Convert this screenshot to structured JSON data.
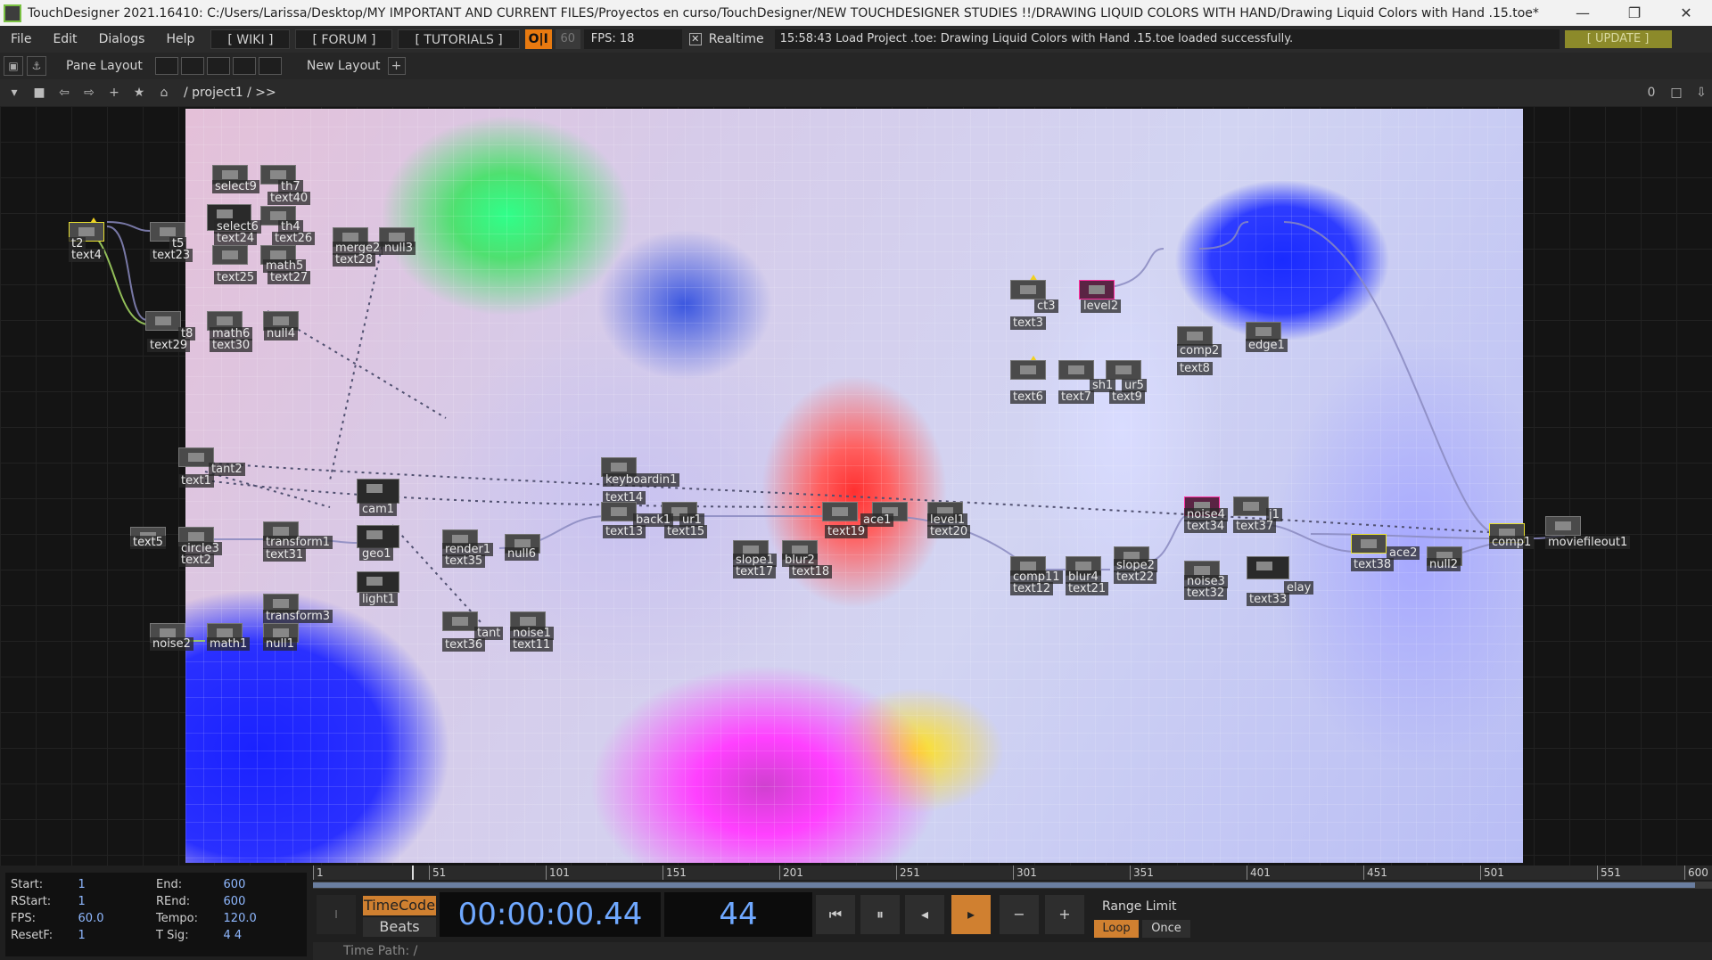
{
  "window": {
    "title": "TouchDesigner 2021.16410: C:/Users/Larissa/Desktop/MY IMPORTANT AND CURRENT FILES/Proyectos en curso/TouchDesigner/NEW TOUCHDESIGNER STUDIES !!/DRAWING LIQUID COLORS WITH HAND/Drawing Liquid Colors with Hand .15.toe*",
    "minimize": "—",
    "restore": "❐",
    "close": "✕"
  },
  "menubar": {
    "file": "File",
    "edit": "Edit",
    "dialogs": "Dialogs",
    "help": "Help",
    "wiki": "[ WIKI ]",
    "forum": "[ FORUM ]",
    "tutorials": "[ TUTORIALS ]",
    "oi": "O|I",
    "fps_target": "60",
    "fps": "FPS: 18",
    "realtime_check": "✕",
    "realtime": "Realtime",
    "status": "15:58:43 Load Project .toe: Drawing Liquid Colors with Hand .15.toe loaded successfully.",
    "update": "[ UPDATE ]"
  },
  "panebar": {
    "pane_layout": "Pane Layout",
    "new_layout": "New Layout",
    "plus": "+"
  },
  "pathbar": {
    "path": "/ project1 / >>",
    "counter": "0"
  },
  "nodes": {
    "t2": "t2",
    "text4": "text4",
    "t5": "t5",
    "text23": "text23",
    "select9": "select9",
    "th7": "th7",
    "text40": "text40",
    "select6": "select6",
    "th4": "th4",
    "text24": "text24",
    "text26": "text26",
    "math5": "math5",
    "text25": "text25",
    "text27": "text27",
    "merge2": "merge2",
    "null3": "null3",
    "text28": "text28",
    "t8": "t8",
    "math6": "math6",
    "null4": "null4",
    "text29": "text29",
    "text30": "text30",
    "tant2": "tant2",
    "text1": "text1",
    "text5": "text5",
    "circle3": "circle3",
    "text2": "text2",
    "transform1": "transform1",
    "text31": "text31",
    "cam1": "cam1",
    "geo1": "geo1",
    "light1": "light1",
    "transform3": "transform3",
    "noise2": "noise2",
    "math1": "math1",
    "null1": "null1",
    "render1": "render1",
    "text35": "text35",
    "null6": "null6",
    "tant": "tant",
    "noise1": "noise1",
    "text36": "text36",
    "text11": "text11",
    "keyboardin1": "keyboardin1",
    "text14": "text14",
    "back1": "back1",
    "ur1": "ur1",
    "text13": "text13",
    "text15": "text15",
    "slope1": "slope1",
    "blur2": "blur2",
    "text17": "text17",
    "text18": "text18",
    "ace1": "ace1",
    "level1": "level1",
    "text19": "text19",
    "text20": "text20",
    "ct3": "ct3",
    "level2": "level2",
    "text3": "text3",
    "comp2": "comp2",
    "text8": "text8",
    "edge1": "edge1",
    "sh1": "sh1",
    "ur5": "ur5",
    "text6": "text6",
    "text7": "text7",
    "text9": "text9",
    "comp11": "comp11",
    "blur4": "blur4",
    "slope2": "slope2",
    "text12": "text12",
    "text21": "text21",
    "text22": "text22",
    "noise4": "noise4",
    "j1": "j1",
    "text34": "text34",
    "text37": "text37",
    "noise3": "noise3",
    "text32": "text32",
    "elay": "elay",
    "text33": "text33",
    "ace2": "ace2",
    "null2": "null2",
    "text38": "text38",
    "comp1": "comp1",
    "moviefileout1": "moviefileout1"
  },
  "timeline": {
    "ticks": [
      "1",
      "51",
      "101",
      "151",
      "201",
      "251",
      "301",
      "351",
      "401",
      "451",
      "501",
      "551",
      "600"
    ],
    "stats": [
      {
        "k1": "Start:",
        "v1": "1",
        "k2": "End:",
        "v2": "600"
      },
      {
        "k1": "RStart:",
        "v1": "1",
        "k2": "REnd:",
        "v2": "600"
      },
      {
        "k1": "FPS:",
        "v1": "60.0",
        "k2": "Tempo:",
        "v2": "120.0"
      },
      {
        "k1": "ResetF:",
        "v1": "1",
        "k2": "T Sig:",
        "v2": "4    4"
      }
    ],
    "timecode_btn": "TimeCode",
    "beats_btn": "Beats",
    "timecode": "00:00:00.44",
    "frame": "44",
    "range_limit": "Range Limit",
    "loop": "Loop",
    "once": "Once",
    "time_path": "Time Path: /",
    "btn_first": "⏮",
    "btn_pause": "⏸",
    "btn_back": "◂",
    "btn_play": "▸",
    "btn_minus": "−",
    "btn_plus": "+",
    "btn_i": "I"
  }
}
